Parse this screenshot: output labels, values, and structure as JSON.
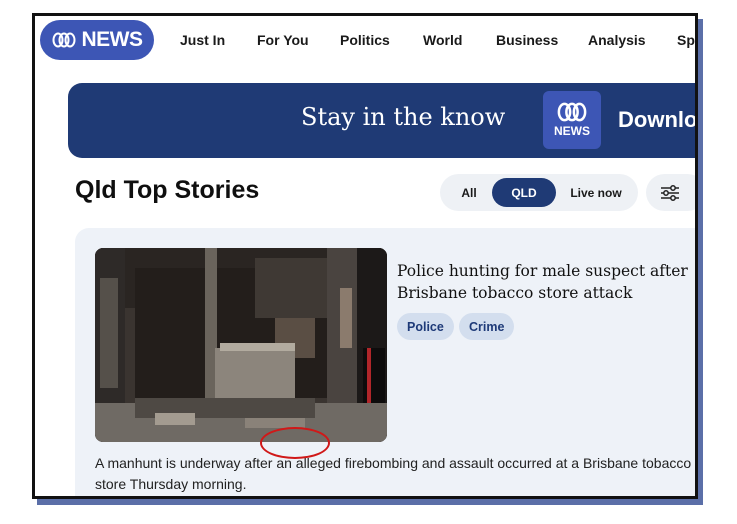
{
  "nav": {
    "logo_text": "NEWS",
    "items": [
      "Just In",
      "For You",
      "Politics",
      "World",
      "Business",
      "Analysis",
      "Sp"
    ]
  },
  "banner": {
    "tagline": "Stay in the know",
    "app_logo_text": "NEWS",
    "cta": "Download"
  },
  "section": {
    "title": "Qld Top Stories",
    "filters": [
      "All",
      "QLD",
      "Live now"
    ],
    "active_filter": "QLD"
  },
  "story": {
    "headline": "Police hunting for male suspect after Brisbane tobacco store attack",
    "tags": [
      "Police",
      "Crime"
    ],
    "summary": "A manhunt is underway after an alleged firebombing and assault occurred at a Brisbane tobacco store Thursday morning."
  },
  "colors": {
    "brand_blue": "#3d56b5",
    "banner_navy": "#1f3a75",
    "card_bg": "#eef2f8",
    "annotation_red": "#d01818"
  },
  "icons": [
    "abc-logo-icon",
    "settings-sliders-icon",
    "app-logo-icon"
  ]
}
